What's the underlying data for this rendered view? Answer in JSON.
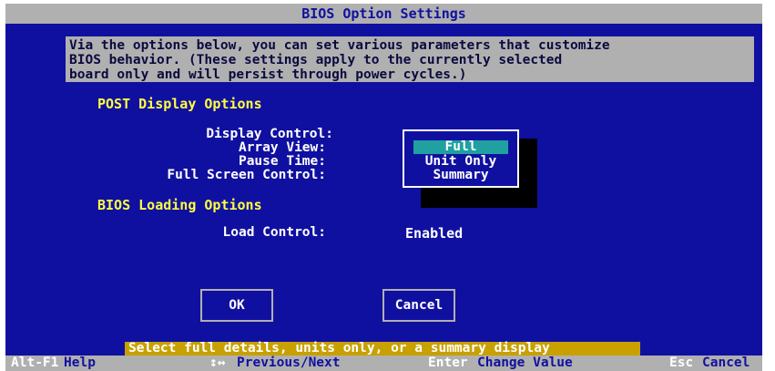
{
  "window": {
    "title": "BIOS Option Settings"
  },
  "intro_text": "Via the options below, you can set various parameters that customize\nBIOS behavior. (These settings apply to the currently selected\nboard only and will persist through power cycles.)",
  "post_section": {
    "heading": "POST Display Options",
    "display_control_label": "Display Control:",
    "array_view_label": "Array View:",
    "pause_time_label": "Pause Time:",
    "full_screen_label": "Full Screen Control:"
  },
  "array_view_popup": {
    "options": [
      "Full",
      "Unit Only",
      "Summary"
    ],
    "selected": "Full"
  },
  "bios_loading_section": {
    "heading": "BIOS Loading Options",
    "load_control_label": "Load Control:",
    "load_control_value": "Enabled"
  },
  "buttons": {
    "ok": "OK",
    "cancel": "Cancel"
  },
  "hint": "Select full details, units only, or a summary display",
  "status_bar": {
    "help_key": "Alt-F1",
    "help_desc": "Help",
    "nav_key": "↕↔",
    "nav_desc": "Previous/Next",
    "enter_key": "Enter",
    "enter_desc": "Change Value",
    "esc_key": "Esc",
    "esc_desc": "Cancel"
  },
  "colors": {
    "background": "#1010a0",
    "panel_gray": "#b0b0b0",
    "section_yellow": "#ffff40",
    "selection_cyan": "#20a0a0",
    "hint_bg": "#c8a000"
  }
}
